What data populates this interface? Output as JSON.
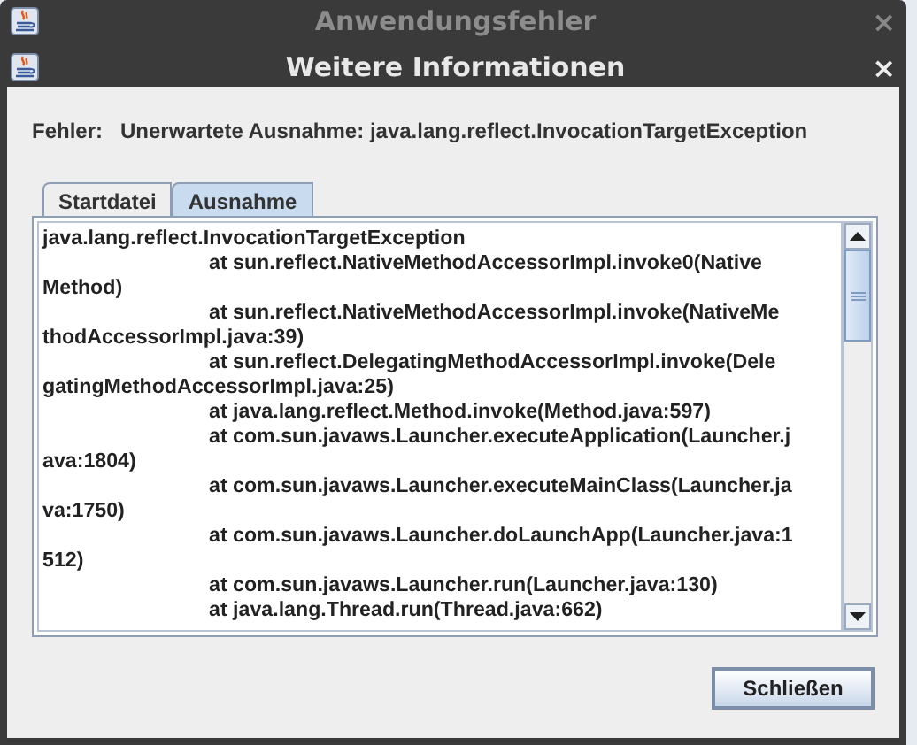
{
  "back_window": {
    "title": "Anwendungsfehler",
    "close": "×"
  },
  "dialog": {
    "title": "Weitere Informationen",
    "close": "×"
  },
  "error": {
    "label": "Fehler:",
    "message": "Unerwartete Ausnahme: java.lang.reflect.InvocationTargetException"
  },
  "tabs": [
    {
      "label": "Startdatei",
      "selected": false
    },
    {
      "label": "Ausnahme",
      "selected": true
    }
  ],
  "trace": [
    {
      "kind": "head",
      "text": "java.lang.reflect.InvocationTargetException"
    },
    {
      "kind": "frame",
      "text": "at sun.reflect.NativeMethodAccessorImpl.invoke0(Native"
    },
    {
      "kind": "wrap",
      "text": "Method)"
    },
    {
      "kind": "frame",
      "text": "at sun.reflect.NativeMethodAccessorImpl.invoke(NativeMe"
    },
    {
      "kind": "wrap",
      "text": "thodAccessorImpl.java:39)"
    },
    {
      "kind": "frame",
      "text": "at sun.reflect.DelegatingMethodAccessorImpl.invoke(Dele"
    },
    {
      "kind": "wrap",
      "text": "gatingMethodAccessorImpl.java:25)"
    },
    {
      "kind": "frame",
      "text": "at java.lang.reflect.Method.invoke(Method.java:597)"
    },
    {
      "kind": "frame",
      "text": "at com.sun.javaws.Launcher.executeApplication(Launcher.j"
    },
    {
      "kind": "wrap",
      "text": "ava:1804)"
    },
    {
      "kind": "frame",
      "text": "at com.sun.javaws.Launcher.executeMainClass(Launcher.ja"
    },
    {
      "kind": "wrap",
      "text": "va:1750)"
    },
    {
      "kind": "frame",
      "text": "at com.sun.javaws.Launcher.doLaunchApp(Launcher.java:1"
    },
    {
      "kind": "wrap",
      "text": "512)"
    },
    {
      "kind": "frame",
      "text": "at com.sun.javaws.Launcher.run(Launcher.java:130)"
    },
    {
      "kind": "frame",
      "text": "at java.lang.Thread.run(Thread.java:662)"
    }
  ],
  "buttons": [
    {
      "label": "Schließen"
    }
  ]
}
